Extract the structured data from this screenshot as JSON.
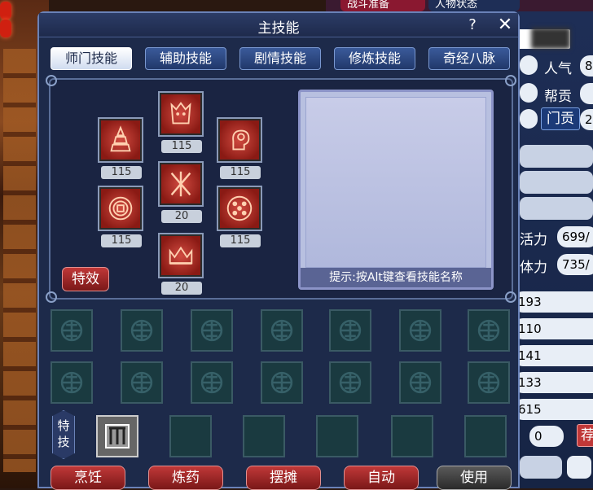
{
  "top_tabs": [
    "战斗准备",
    "人物状态"
  ],
  "window": {
    "title": "主技能",
    "help_label": "?",
    "close_label": "✕"
  },
  "tabs": [
    {
      "label": "师门技能",
      "active": true
    },
    {
      "label": "辅助技能",
      "active": false
    },
    {
      "label": "剧情技能",
      "active": false
    },
    {
      "label": "修炼技能",
      "active": false
    },
    {
      "label": "奇经八脉",
      "active": false
    }
  ],
  "skills": [
    {
      "icon": "pagoda-icon",
      "level": "115"
    },
    {
      "icon": "demon-mask-icon",
      "level": "115"
    },
    {
      "icon": "profile-head-icon",
      "level": "115"
    },
    {
      "icon": "crossed-blades-icon",
      "level": "20"
    },
    {
      "icon": "coin-seal-icon",
      "level": "115"
    },
    {
      "icon": "dice-grid-icon",
      "level": "115"
    },
    {
      "icon": "crown-spikes-icon",
      "level": "20"
    }
  ],
  "effect_button": "特效",
  "hint_text": "提示:按Alt键查看技能名称",
  "special_tag": "特技",
  "bottom_buttons": [
    {
      "label": "烹饪",
      "style": "red"
    },
    {
      "label": "炼药",
      "style": "red"
    },
    {
      "label": "摆摊",
      "style": "red"
    },
    {
      "label": "自动",
      "style": "red"
    },
    {
      "label": "使用",
      "style": "gray"
    }
  ],
  "right_panel": {
    "popularity_label": "人气",
    "popularity_value": "8",
    "contribution_label": "帮贡",
    "sect_contribution_label": "门贡",
    "sect_contribution_value": "2",
    "vitality_label": "活力",
    "vitality_value": "699/",
    "stamina_label": "体力",
    "stamina_value": "735/",
    "stats": [
      "193",
      "110",
      "141",
      "133",
      "615"
    ],
    "points_value": "0",
    "recommend_label": "荐"
  },
  "colors": {
    "window_bg": "#1d2a4a",
    "accent_red": "#c03838",
    "tab_active": "#ffffff"
  }
}
